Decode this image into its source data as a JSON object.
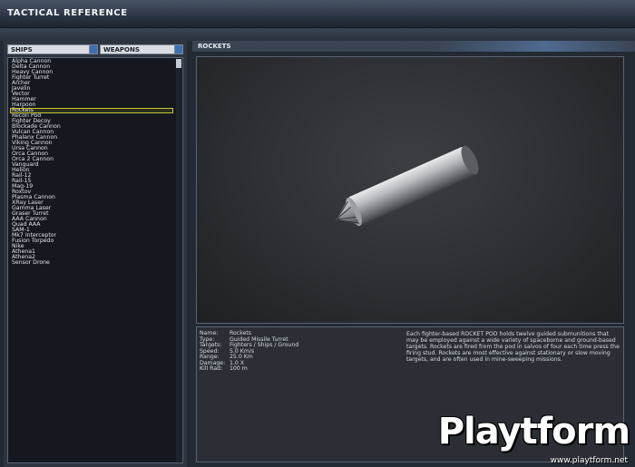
{
  "window": {
    "title": "TACTICAL REFERENCE"
  },
  "filters": {
    "category_left": "SHIPS",
    "category_right": "WEAPONS"
  },
  "list": {
    "items": [
      "Alpha Cannon",
      "Delta Cannon",
      "Heavy Cannon",
      "Fighter Turret",
      "Archer",
      "Javelin",
      "Vector",
      "Hammer",
      "Harpoon",
      "Rockets",
      "Recon Pod",
      "Fighter Decoy",
      "Blockade Cannon",
      "Vulcan Cannon",
      "Phalanx Cannon",
      "Viking Cannon",
      "Ursa Cannon",
      "Orca Cannon",
      "Orca 2 Cannon",
      "Vanguard",
      "Helion",
      "Rail-12",
      "Rail-15",
      "Mag-19",
      "Roxtov",
      "Plasma Cannon",
      "XRay Laser",
      "Gamma Laser",
      "Graser Turret",
      "AAA Cannon",
      "Quad AAA",
      "SAM-1",
      "Mk7 Interceptor",
      "Fusion Torpedo",
      "Nike",
      "Athena1",
      "Athena2",
      "Sensor Drone"
    ],
    "selected_index": 9
  },
  "viewer": {
    "title": "ROCKETS"
  },
  "details": {
    "stats": [
      {
        "key": "Name:",
        "value": "Rockets"
      },
      {
        "key": "Type:",
        "value": "Guided Missile Turret"
      },
      {
        "key": "Targets:",
        "value": "Fighters / Ships / Ground"
      },
      {
        "key": "Speed:",
        "value": "5.0 Km/s"
      },
      {
        "key": "Range:",
        "value": "25.0 Km"
      },
      {
        "key": "Damage:",
        "value": "1.0 X"
      },
      {
        "key": "Kill Rad:",
        "value": "100 m"
      }
    ],
    "description": "Each fighter-based ROCKET POD holds twelve guided submunitions that may be employed against a wide variety of spaceborne and ground-based targets. Rockets are fired from the pod in salvos of four each time press the firing stud. Rockets are most effective against stationary or slow moving targets, and are often used in mine-sweeping missions."
  },
  "watermark": {
    "brand": "Playtform",
    "url": "www.playtform.net"
  },
  "colors": {
    "selection": "#c9c23a",
    "accent_blue": "#3d6fb0"
  }
}
